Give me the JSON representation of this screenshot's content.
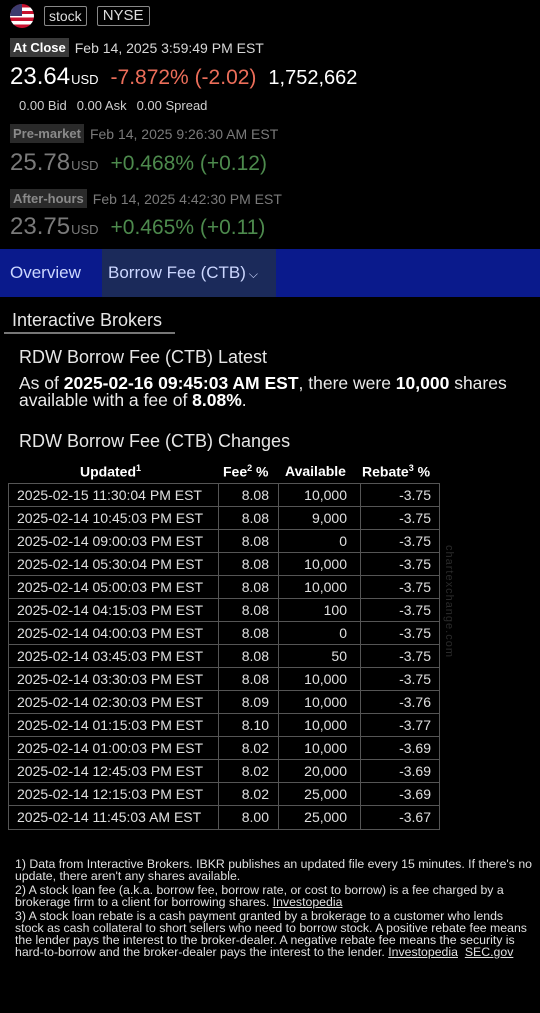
{
  "header": {
    "type_tag": "stock",
    "exchange_tag": "NYSE"
  },
  "close": {
    "badge": "At Close",
    "time": "Feb 14, 2025 3:59:49 PM EST",
    "price": "23.64",
    "currency": "USD",
    "change": "-7.872% (-2.02)",
    "volume": "1,752,662",
    "bid": "0.00 Bid",
    "ask": "0.00 Ask",
    "spread": "0.00 Spread"
  },
  "premarket": {
    "badge": "Pre-market",
    "time": "Feb 14, 2025 9:26:30 AM EST",
    "price": "25.78",
    "currency": "USD",
    "change": "+0.468% (+0.12)"
  },
  "afterhours": {
    "badge": "After-hours",
    "time": "Feb 14, 2025 4:42:30 PM EST",
    "price": "23.75",
    "currency": "USD",
    "change": "+0.465% (+0.11)"
  },
  "tabs": {
    "overview": "Overview",
    "borrow": "Borrow Fee (CTB)"
  },
  "source_label": "Interactive Brokers",
  "latest": {
    "heading": "RDW Borrow Fee (CTB) Latest",
    "p1": "As of ",
    "timestamp": "2025-02-16 09:45:03 AM EST",
    "p2": ", there were ",
    "shares": "10,000",
    "p3": " shares available with a fee of ",
    "fee": "8.08%",
    "p4": "."
  },
  "changes": {
    "heading": "RDW Borrow Fee (CTB) Changes",
    "columns": {
      "updated": "Updated",
      "updated_sup": "1",
      "fee": "Fee",
      "fee_sup": "2",
      "fee_unit": " %",
      "available": "Available",
      "rebate": "Rebate",
      "rebate_sup": "3",
      "rebate_unit": " %"
    },
    "rows": [
      [
        "2025-02-15 11:30:04 PM EST",
        "8.08",
        "10,000",
        "-3.75"
      ],
      [
        "2025-02-14 10:45:03 PM EST",
        "8.08",
        "9,000",
        "-3.75"
      ],
      [
        "2025-02-14 09:00:03 PM EST",
        "8.08",
        "0",
        "-3.75"
      ],
      [
        "2025-02-14 05:30:04 PM EST",
        "8.08",
        "10,000",
        "-3.75"
      ],
      [
        "2025-02-14 05:00:03 PM EST",
        "8.08",
        "10,000",
        "-3.75"
      ],
      [
        "2025-02-14 04:15:03 PM EST",
        "8.08",
        "100",
        "-3.75"
      ],
      [
        "2025-02-14 04:00:03 PM EST",
        "8.08",
        "0",
        "-3.75"
      ],
      [
        "2025-02-14 03:45:03 PM EST",
        "8.08",
        "50",
        "-3.75"
      ],
      [
        "2025-02-14 03:30:03 PM EST",
        "8.08",
        "10,000",
        "-3.75"
      ],
      [
        "2025-02-14 02:30:03 PM EST",
        "8.09",
        "10,000",
        "-3.76"
      ],
      [
        "2025-02-14 01:15:03 PM EST",
        "8.10",
        "10,000",
        "-3.77"
      ],
      [
        "2025-02-14 01:00:03 PM EST",
        "8.02",
        "10,000",
        "-3.69"
      ],
      [
        "2025-02-14 12:45:03 PM EST",
        "8.02",
        "20,000",
        "-3.69"
      ],
      [
        "2025-02-14 12:15:03 PM EST",
        "8.02",
        "25,000",
        "-3.69"
      ],
      [
        "2025-02-14 11:45:03 AM EST",
        "8.00",
        "25,000",
        "-3.67"
      ]
    ]
  },
  "watermark": "chartexchange.com",
  "footnotes": {
    "n1": "1) Data from Interactive Brokers. IBKR publishes an updated file every 15 minutes. If there's no update, there aren't any shares available.",
    "n2": "2) A stock loan fee (a.k.a. borrow fee, borrow rate, or cost to borrow) is a fee charged by a brokerage firm to a client for borrowing shares. ",
    "n2_link": "Investopedia",
    "n3": "3) A stock loan rebate is a cash payment granted by a brokerage to a customer who lends stock as cash collateral to short sellers who need to borrow stock. A positive rebate fee means the lender pays the interest to the broker-dealer. A negative rebate fee means the security is hard-to-borrow and the broker-dealer pays the interest to the lender. ",
    "n3_link1": "Investopedia",
    "n3_link2": "SEC.gov"
  }
}
